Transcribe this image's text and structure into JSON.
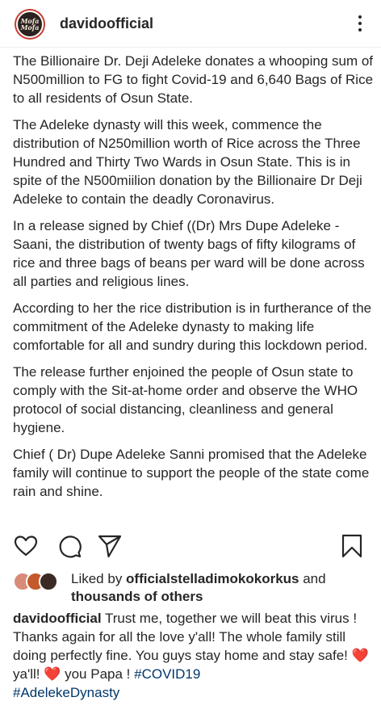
{
  "post": {
    "username": "davidoofficial",
    "avatar_text_line1": "Mofa",
    "avatar_text_line2": "Mofa"
  },
  "article": {
    "paragraphs": [
      "The Billionaire Dr. Deji Adeleke donates a whooping sum of N500million to FG to fight Covid-19 and 6,640 Bags of Rice to all residents of Osun State.",
      "The Adeleke dynasty will this week, commence the distribution of N250million worth of Rice across the Three Hundred and Thirty Two Wards in Osun State. This is in spite of the N500miilion donation by the Billionaire Dr Deji Adeleke to contain the deadly Coronavirus.",
      "In a release signed by Chief ((Dr) Mrs Dupe Adeleke - Saani, the distribution of twenty bags of fifty kilograms of rice and three bags of beans per ward will be done across all parties and religious lines.",
      "According to her the rice distribution is in furtherance of the commitment of the Adeleke dynasty to making life comfortable for all and sundry during this lockdown period.",
      "The release further enjoined the people of Osun state to comply with the Sit-at-home order and observe the WHO protocol of social distancing, cleanliness and general hygiene.",
      "Chief ( Dr) Dupe Adeleke Sanni promised that the Adeleke family will continue to support the people of the state come rain and shine."
    ]
  },
  "actions": {
    "like_icon": "heart-outline-icon",
    "comment_icon": "comment-bubble-icon",
    "share_icon": "paper-plane-icon",
    "save_icon": "bookmark-icon"
  },
  "likes": {
    "prefix": "Liked by ",
    "user": "officialstelladimokokorkus",
    "middle": " and",
    "others": "thousands of others"
  },
  "caption": {
    "author": "davidoofficial",
    "text1": " Trust me, together we will beat this virus ! Thanks again for all the love y'all! The whole family still doing perfectly fine. You guys stay home and stay safe! ",
    "heart1": "❤️",
    "text2": " ya'll! ",
    "heart2": "❤️",
    "text3": " you Papa ! ",
    "tag1": "#COVID19",
    "tag2": "#AdelekeDynasty"
  },
  "colors": {
    "text": "#262626",
    "hashtag": "#00376b",
    "heart": "#e3242b",
    "avatar_ring": "#c83a2e"
  }
}
